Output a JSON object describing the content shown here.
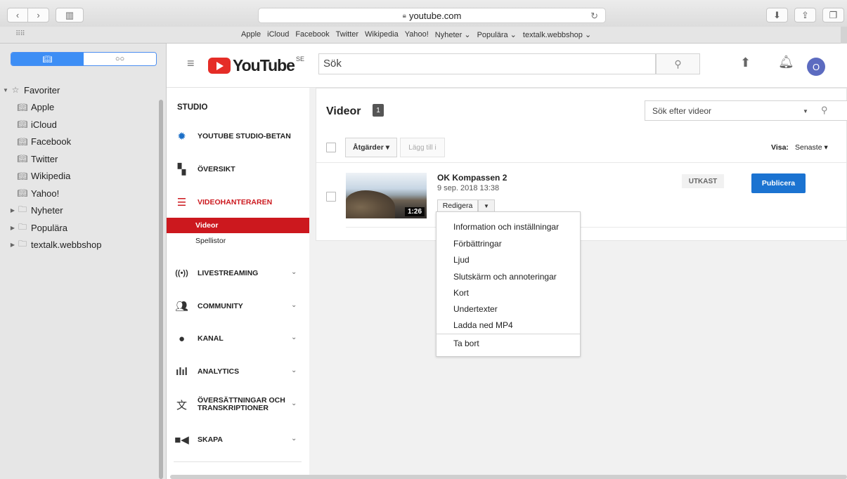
{
  "browser": {
    "url": "youtube.com",
    "bookmarks": [
      "Apple",
      "iCloud",
      "Facebook",
      "Twitter",
      "Wikipedia",
      "Yahoo!",
      "Nyheter ⌄",
      "Populära ⌄",
      "textalk.webbshop ⌄"
    ]
  },
  "safari_sidebar": {
    "favorites_label": "Favoriter",
    "items": [
      "Apple",
      "iCloud",
      "Facebook",
      "Twitter",
      "Wikipedia",
      "Yahoo!"
    ],
    "folders": [
      "Nyheter",
      "Populära",
      "textalk.webbshop"
    ]
  },
  "yt_header": {
    "logo_text": "YouTube",
    "country": "SE",
    "search_placeholder": "Sök",
    "avatar_letter": "O"
  },
  "studio_sidebar": {
    "heading": "STUDIO",
    "items": {
      "studio_beta": "YOUTUBE STUDIO-BETAN",
      "overview": "ÖVERSIKT",
      "video_manager": "VIDEOHANTERAREN",
      "videos": "Videor",
      "playlists": "Spellistor",
      "livestreaming": "LIVESTREAMING",
      "community": "COMMUNITY",
      "channel": "KANAL",
      "analytics": "ANALYTICS",
      "translations_line1": "ÖVERSÄTTNINGAR OCH",
      "translations_line2": "TRANSKRIPTIONER",
      "create": "SKAPA"
    }
  },
  "main": {
    "title": "Videor",
    "count": "1",
    "search_placeholder": "Sök efter videor",
    "actions_label": "Åtgärder ▾",
    "add_to_label": "Lägg till i",
    "view_label": "Visa:",
    "view_value": "Senaste ▾",
    "video": {
      "title": "OK Kompassen 2",
      "date": "9 sep. 2018 13:38",
      "duration": "1:26",
      "edit_label": "Redigera",
      "status": "UTKAST",
      "publish_label": "Publicera"
    }
  },
  "dropdown": {
    "items": [
      "Information och inställningar",
      "Förbättringar",
      "Ljud",
      "Slutskärm och annoteringar",
      "Kort",
      "Undertexter",
      "Ladda ned MP4"
    ],
    "delete": "Ta bort"
  },
  "colors": {
    "youtube_red": "#cc181e",
    "publish_blue": "#1b73d1",
    "safari_accent": "#3d8ef5"
  }
}
